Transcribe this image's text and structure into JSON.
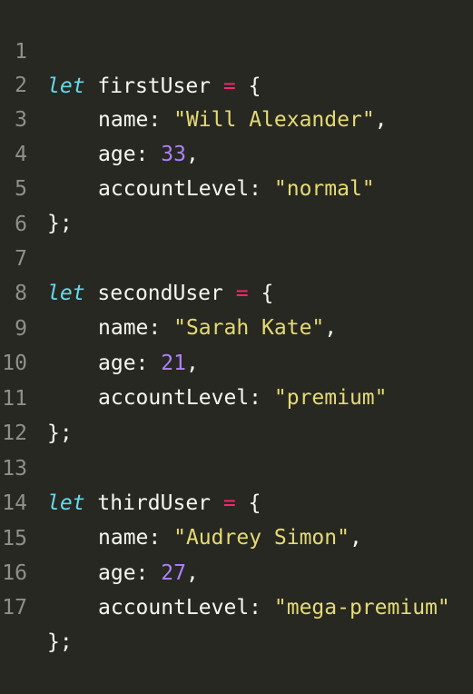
{
  "colors": {
    "background": "#272822",
    "line_number": "#90908a",
    "keyword": "#66d9ef",
    "operator": "#f92672",
    "string": "#e6db74",
    "number": "#ae81ff",
    "text": "#f8f8f2"
  },
  "lines": [
    {
      "no": "1",
      "kw": "let",
      "name": "firstUser",
      "op": "=",
      "brace": "{"
    },
    {
      "no": "2",
      "key": "name:",
      "str": "\"Will Alexander\"",
      "comma": ","
    },
    {
      "no": "3",
      "key": "age:",
      "num": "33",
      "comma": ","
    },
    {
      "no": "4",
      "key": "accountLevel:",
      "str": "\"normal\""
    },
    {
      "no": "5",
      "text": "};"
    },
    {
      "no": "6"
    },
    {
      "no": "7",
      "kw": "let",
      "name": "secondUser",
      "op": "=",
      "brace": "{"
    },
    {
      "no": "8",
      "key": "name:",
      "str": "\"Sarah Kate\"",
      "comma": ","
    },
    {
      "no": "9",
      "key": "age:",
      "num": "21",
      "comma": ","
    },
    {
      "no": "10",
      "key": "accountLevel:",
      "str": "\"premium\""
    },
    {
      "no": "11",
      "text": "};"
    },
    {
      "no": "12"
    },
    {
      "no": "13",
      "kw": "let",
      "name": "thirdUser",
      "op": "=",
      "brace": "{"
    },
    {
      "no": "14",
      "key": "name:",
      "str": "\"Audrey Simon\"",
      "comma": ","
    },
    {
      "no": "15",
      "key": "age:",
      "num": "27",
      "comma": ","
    },
    {
      "no": "16",
      "key": "accountLevel:",
      "str": "\"mega-premium\""
    },
    {
      "no": "17",
      "text": "};"
    }
  ]
}
